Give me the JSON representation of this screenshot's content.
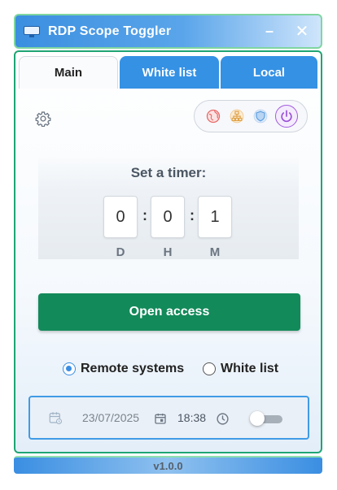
{
  "window": {
    "title": "RDP Scope Toggler",
    "minimize_label": "–",
    "close_label": "✕"
  },
  "tabs": [
    {
      "label": "Main",
      "active": true
    },
    {
      "label": "White list",
      "active": false
    },
    {
      "label": "Local",
      "active": false
    }
  ],
  "scope_buttons": [
    {
      "icon": "globe-icon",
      "color": "#e86a6a"
    },
    {
      "icon": "network-icon",
      "color": "#e0a24a"
    },
    {
      "icon": "shield-icon",
      "color": "#5b9de0"
    },
    {
      "icon": "power-icon",
      "color": "#9a4fd8",
      "selected": true
    }
  ],
  "timer": {
    "title": "Set a timer:",
    "days": "0",
    "hours": "0",
    "minutes": "1",
    "separator": ":",
    "units": [
      "D",
      "H",
      "M"
    ]
  },
  "actions": {
    "open_access_label": "Open access"
  },
  "scope_mode": {
    "options": [
      {
        "label": "Remote systems",
        "checked": true
      },
      {
        "label": "White list",
        "checked": false
      }
    ]
  },
  "schedule": {
    "date": "23/07/2025",
    "time": "18:38",
    "enabled": false
  },
  "footer": {
    "version": "v1.0.0"
  },
  "colors": {
    "accent": "#3a8ee2",
    "primary_button": "#128a5a",
    "border_green": "#1fa574"
  }
}
